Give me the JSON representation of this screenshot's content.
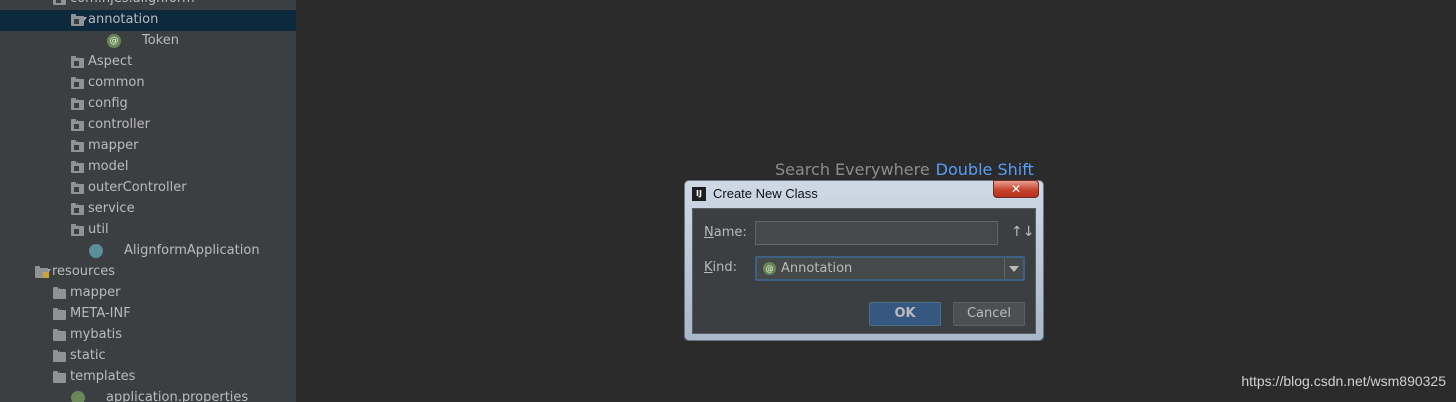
{
  "tree": {
    "rows": [
      {
        "label": "com.hjes.alignform",
        "kind": "package",
        "state": "expanded",
        "indent": 70
      },
      {
        "label": "annotation",
        "kind": "package",
        "state": "expanded",
        "indent": 88,
        "selected": true
      },
      {
        "label": "Token",
        "kind": "annotation-class",
        "state": "none",
        "indent": 106
      },
      {
        "label": "Aspect",
        "kind": "package",
        "state": "collapsed",
        "indent": 88
      },
      {
        "label": "common",
        "kind": "package",
        "state": "collapsed",
        "indent": 88
      },
      {
        "label": "config",
        "kind": "package",
        "state": "collapsed",
        "indent": 88
      },
      {
        "label": "controller",
        "kind": "package",
        "state": "collapsed",
        "indent": 88
      },
      {
        "label": "mapper",
        "kind": "package",
        "state": "collapsed",
        "indent": 88
      },
      {
        "label": "model",
        "kind": "package",
        "state": "collapsed",
        "indent": 88
      },
      {
        "label": "outerController",
        "kind": "package",
        "state": "collapsed",
        "indent": 88
      },
      {
        "label": "service",
        "kind": "package",
        "state": "collapsed",
        "indent": 88
      },
      {
        "label": "util",
        "kind": "package",
        "state": "collapsed",
        "indent": 88
      },
      {
        "label": "AlignformApplication",
        "kind": "app-class",
        "state": "none",
        "indent": 88
      },
      {
        "label": "resources",
        "kind": "resources",
        "state": "expanded",
        "indent": 52
      },
      {
        "label": "mapper",
        "kind": "folder",
        "state": "collapsed",
        "indent": 70
      },
      {
        "label": "META-INF",
        "kind": "folder",
        "state": "collapsed",
        "indent": 70
      },
      {
        "label": "mybatis",
        "kind": "folder",
        "state": "collapsed",
        "indent": 70
      },
      {
        "label": "static",
        "kind": "folder",
        "state": "collapsed",
        "indent": 70
      },
      {
        "label": "templates",
        "kind": "folder",
        "state": "collapsed",
        "indent": 70
      },
      {
        "label": "application.properties",
        "kind": "properties",
        "state": "none",
        "indent": 70
      }
    ]
  },
  "editor": {
    "hint_text": "Search Everywhere",
    "hint_shortcut": "Double Shift"
  },
  "watermark": "https://blog.csdn.net/wsm890325",
  "dialog": {
    "app_icon_text": "IJ",
    "title": "Create New Class",
    "close_glyph": "✕",
    "name_label_first": "N",
    "name_label_rest": "ame:",
    "name_value": "",
    "sort_glyph": "↑↓",
    "kind_label_first": "K",
    "kind_label_rest": "ind:",
    "kind_icon_glyph": "@",
    "kind_value": "Annotation",
    "ok_label": "OK",
    "cancel_label": "Cancel"
  },
  "colors": {
    "tree_bg": "#3c3f41",
    "selection": "#0d293e",
    "editor_bg": "#2b2b2b",
    "shortcut_accent": "#589df6",
    "ok_button": "#365880"
  }
}
